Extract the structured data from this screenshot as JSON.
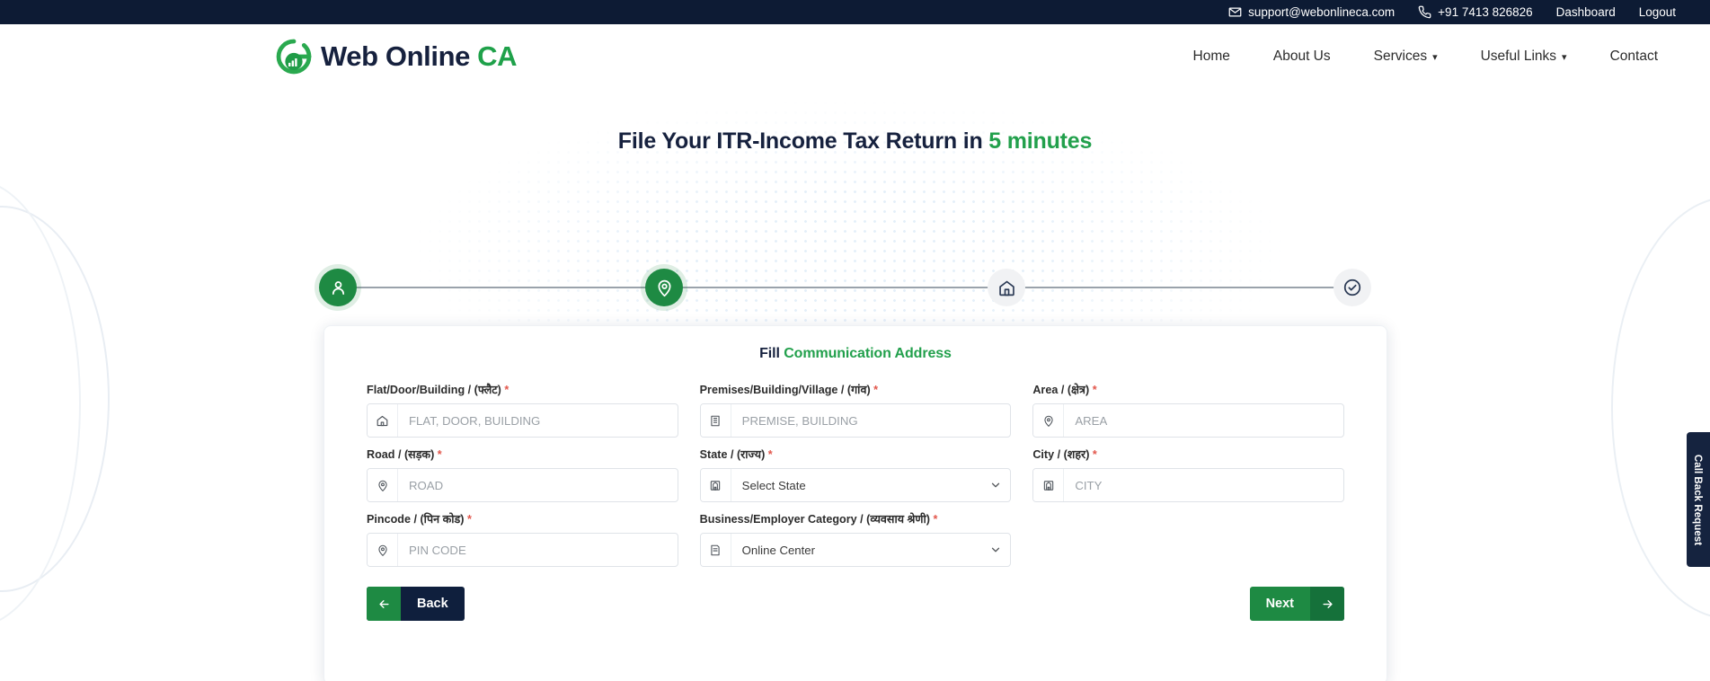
{
  "topbar": {
    "email": "support@webonlineca.com",
    "phone": "+91 7413 826826",
    "dashboard": "Dashboard",
    "logout": "Logout",
    "email_icon": "mail-icon",
    "phone_icon": "phone-icon",
    "bg_color": "#0d1b34"
  },
  "header": {
    "logo_icon": "web-online-ca-logo-icon",
    "logo_text_dark": "Web Online",
    "logo_text_green": "CA",
    "nav": [
      {
        "label": "Home",
        "has_caret": false
      },
      {
        "label": "About Us",
        "has_caret": false
      },
      {
        "label": "Services",
        "has_caret": true
      },
      {
        "label": "Useful Links",
        "has_caret": true
      },
      {
        "label": "Contact",
        "has_caret": false
      }
    ]
  },
  "hero": {
    "title_main": "File Your ITR-Income Tax Return in ",
    "title_accent": "5 minutes",
    "accent_color": "#22a04c"
  },
  "stepper": {
    "steps": [
      {
        "icon": "person-icon",
        "state": "active"
      },
      {
        "icon": "location-pin-icon",
        "state": "active"
      },
      {
        "icon": "home-icon",
        "state": "idle"
      },
      {
        "icon": "check-circle-icon",
        "state": "idle"
      }
    ],
    "active_color": "#1e8a43",
    "idle_color": "#f1f2f4"
  },
  "card": {
    "title_dark": "Fill ",
    "title_green": "Communication Address",
    "fields": [
      {
        "label": "Flat/Door/Building / (फ्लैट)",
        "required": true,
        "icon": "home-outline-icon",
        "type": "input",
        "value": "",
        "placeholder": "FLAT, DOOR, BUILDING"
      },
      {
        "label": "Premises/Building/Village / (गांव)",
        "required": true,
        "icon": "building-icon",
        "type": "input",
        "value": "",
        "placeholder": "PREMISE, BUILDING"
      },
      {
        "label": "Area / (क्षेत्र)",
        "required": true,
        "icon": "location-pin-icon",
        "type": "input",
        "value": "",
        "placeholder": "AREA"
      },
      {
        "label": "Road / (सड़क)",
        "required": true,
        "icon": "location-pin-icon",
        "type": "input",
        "value": "",
        "placeholder": "ROAD"
      },
      {
        "label": "State / (राज्य)",
        "required": true,
        "icon": "map-icon",
        "type": "select",
        "value": "Select State",
        "placeholder": "Select State"
      },
      {
        "label": "City / (शहर)",
        "required": true,
        "icon": "map-icon",
        "type": "input",
        "value": "",
        "placeholder": "CITY"
      },
      {
        "label": "Pincode / (पिन कोड)",
        "required": true,
        "icon": "location-pin-icon",
        "type": "input",
        "value": "",
        "placeholder": "PIN CODE"
      },
      {
        "label": "Business/Employer Category / (व्यवसाय श्रेणी)",
        "required": true,
        "icon": "note-icon",
        "type": "select",
        "value": "Online Center",
        "placeholder": "Online Center"
      }
    ],
    "back_label": "Back",
    "next_label": "Next",
    "back_icon": "arrow-left-icon",
    "next_icon": "arrow-right-icon"
  },
  "sidetab": {
    "label": "Call Back Request"
  }
}
